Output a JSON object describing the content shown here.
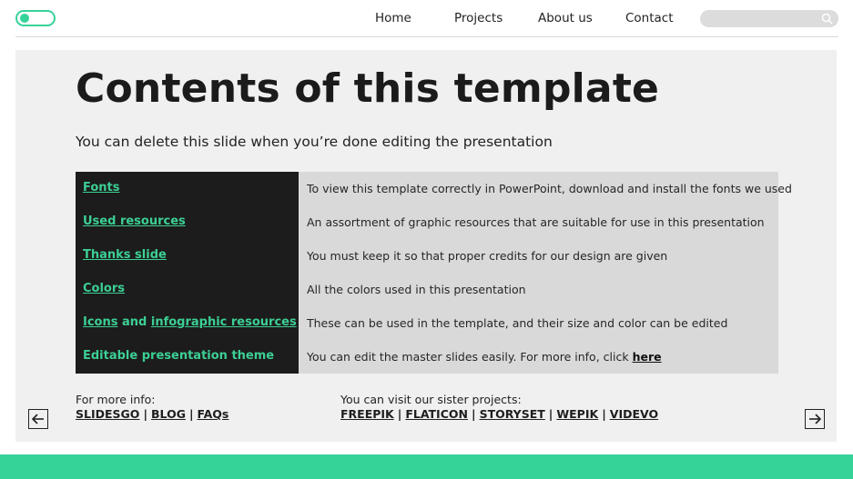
{
  "header": {
    "nav": [
      "Home",
      "Projects",
      "About us",
      "Contact"
    ],
    "search": {
      "placeholder": ""
    },
    "accent_color": "#36d399"
  },
  "slide": {
    "title": "Contents of this template",
    "subtitle": "You can delete this slide when you’re done editing the presentation"
  },
  "table": {
    "rows": [
      {
        "key": "Fonts",
        "desc": "To view this template correctly in PowerPoint, download and install the fonts we used"
      },
      {
        "key": "Used resources",
        "desc": "An assortment of graphic resources that are suitable for use in this presentation"
      },
      {
        "key": "Thanks slide",
        "desc": "You must keep it so that proper credits for our design are given"
      },
      {
        "key": "Colors",
        "desc": "All the colors used in this presentation"
      },
      {
        "key_parts": [
          "Icons",
          " and ",
          "infographic resources"
        ],
        "desc": "These can be used in the template, and their size and color can be edited"
      },
      {
        "key": "Editable presentation theme",
        "desc": "You can edit the master slides easily. For more info, click ",
        "desc_link": "here"
      }
    ],
    "dark_color": "#1c1c1c",
    "light_color": "#d9d9d9",
    "key_color": "#3ccf94"
  },
  "footer": {
    "more_info_label": "For more info:",
    "more_info_links": [
      "SLIDESGO",
      "BLOG",
      "FAQs"
    ],
    "sister_label": "You can visit our sister projects:",
    "sister_links": [
      "FREEPIK",
      "FLATICON",
      "STORYSET",
      "WEPIK",
      "VIDEVO"
    ],
    "separator": "|"
  },
  "icons": {
    "toggle": "toggle-switch-icon",
    "search": "search-icon",
    "prev": "arrow-left-icon",
    "next": "arrow-right-icon"
  }
}
